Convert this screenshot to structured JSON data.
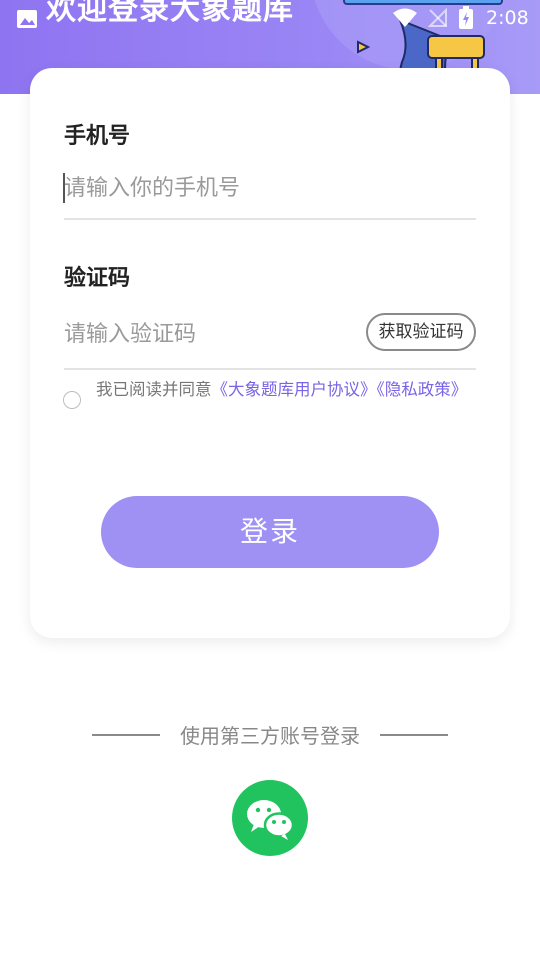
{
  "status_bar": {
    "time": "2:08",
    "icons": [
      "gallery-icon",
      "wifi-icon",
      "signal-off-icon",
      "battery-charging-icon"
    ]
  },
  "header": {
    "title_partial": "欢迎登录大象题库",
    "background_colors": [
      "#8f74f1",
      "#a79bf7"
    ]
  },
  "form": {
    "phone": {
      "label": "手机号",
      "placeholder": "请输入你的手机号",
      "value": ""
    },
    "code": {
      "label": "验证码",
      "placeholder": "请输入验证码",
      "value": "",
      "get_code_button": "获取验证码"
    },
    "agreement": {
      "checked": false,
      "prefix": "我已阅读并同意",
      "user_agreement_link": "《大象题库用户协议》",
      "privacy_link": "《隐私政策》"
    },
    "login_button": "登录"
  },
  "third_party": {
    "label": "使用第三方账号登录",
    "providers": [
      "wechat-icon"
    ]
  },
  "colors": {
    "accent": "#9f90f4",
    "link": "#7a63e6",
    "wechat": "#21c35f"
  }
}
